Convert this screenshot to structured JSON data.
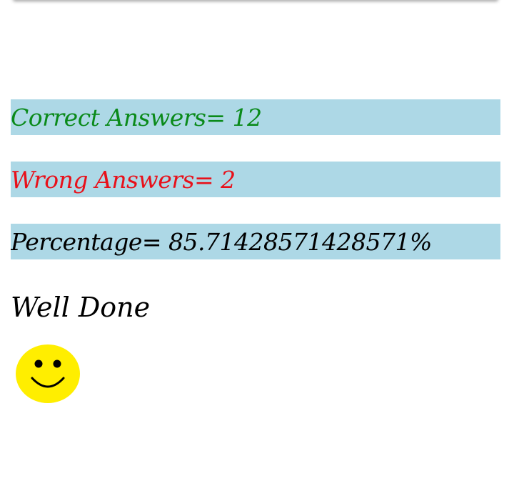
{
  "results": {
    "correct": {
      "label": "Correct Answers= 12",
      "color": "#0a8a1a"
    },
    "wrong": {
      "label": "Wrong Answers= 2",
      "color": "#e8101a"
    },
    "percentage": {
      "label": "Percentage= 85.71428571428571%",
      "color": "#000000"
    }
  },
  "row_background": "#add8e6",
  "message": "Well Done",
  "feedback_icon": "smiley-face-icon",
  "smiley_color": "#ffee00"
}
